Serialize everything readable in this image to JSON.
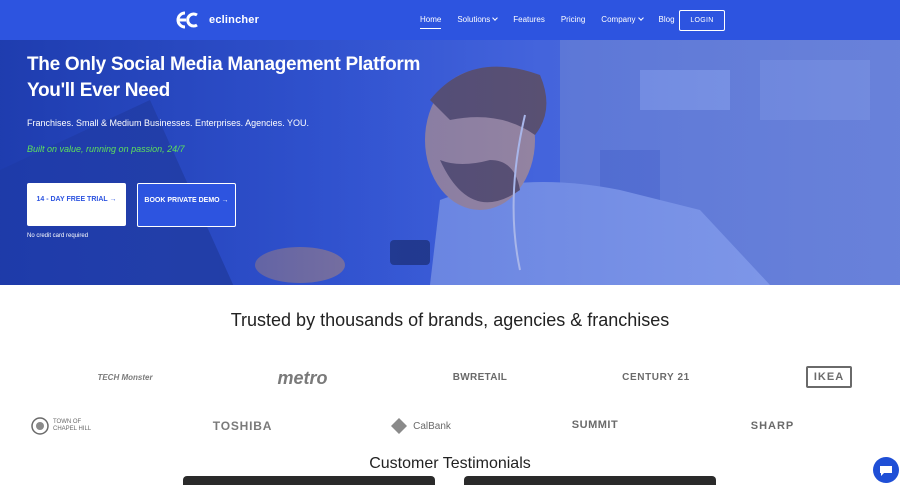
{
  "brand": {
    "name": "eclincher"
  },
  "nav": {
    "items": [
      {
        "label": "Home",
        "active": true,
        "dropdown": false
      },
      {
        "label": "Solutions",
        "active": false,
        "dropdown": true
      },
      {
        "label": "Features",
        "active": false,
        "dropdown": false
      },
      {
        "label": "Pricing",
        "active": false,
        "dropdown": false
      },
      {
        "label": "Company",
        "active": false,
        "dropdown": true
      },
      {
        "label": "Blog",
        "active": false,
        "dropdown": false
      }
    ],
    "login_label": "LOGIN"
  },
  "hero": {
    "title": "The Only Social Media Management Platform You'll Ever Need",
    "subtitle": "Franchises. Small & Medium Businesses. Enterprises. Agencies. YOU.",
    "tagline": "Built on value, running on passion, 24/7",
    "trial_button": "14 - DAY FREE TRIAL →",
    "demo_button": "BOOK PRIVATE DEMO →",
    "note": "No credit card required"
  },
  "trusted": {
    "heading": "Trusted by thousands of brands, agencies & franchises",
    "logos": [
      "TECH Monster",
      "metro",
      "BWRETAIL",
      "CENTURY 21",
      "IKEA",
      "TOWN OF CHAPEL HILL",
      "TOSHIBA",
      "CalBank",
      "SUMMIT",
      "SHARP"
    ]
  },
  "testimonials": {
    "heading": "Customer Testimonials"
  },
  "colors": {
    "brand_blue": "#2d54e0",
    "tagline_green": "#5ee05c",
    "text_dark": "#222222"
  },
  "icons": [
    "eclincher-logo-icon",
    "chevron-down-icon",
    "arrow-right-icon",
    "chat-icon",
    "play-icon"
  ]
}
